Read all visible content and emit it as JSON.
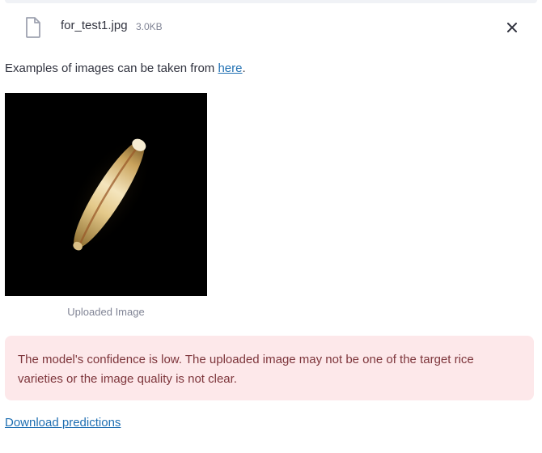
{
  "file": {
    "name": "for_test1.jpg",
    "size": "3.0KB",
    "icon": "file-icon",
    "remove_icon": "close-icon"
  },
  "examples": {
    "prefix": "Examples of images can be taken from ",
    "link_label": "here",
    "suffix": "."
  },
  "image": {
    "caption": "Uploaded Image"
  },
  "alert": {
    "message": "The model's confidence is low. The uploaded image may not be one of the target rice varieties or the image quality is not clear.",
    "background": "#fde8ea",
    "text_color": "#7d353b"
  },
  "download": {
    "label": "Download predictions"
  },
  "colors": {
    "link": "#1f6fb2",
    "text": "#31333f",
    "muted": "#808495"
  }
}
